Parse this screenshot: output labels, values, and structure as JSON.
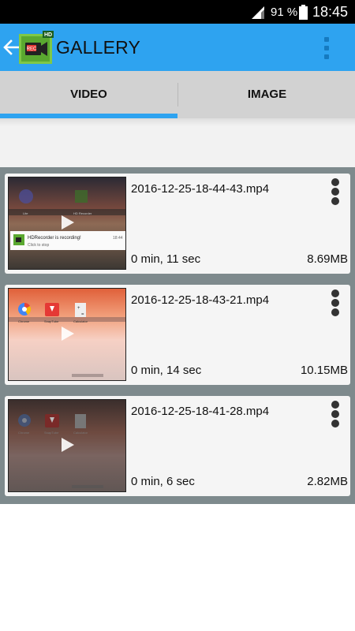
{
  "status_bar": {
    "battery_percent": "91 %",
    "time": "18:45"
  },
  "app_bar": {
    "title": "GALLERY",
    "logo_text": "REC",
    "logo_badge": "HD"
  },
  "tabs": [
    {
      "label": "VIDEO",
      "selected": true
    },
    {
      "label": "IMAGE",
      "selected": false
    }
  ],
  "videos": [
    {
      "filename": "2016-12-25-18-44-43.mp4",
      "duration": "0 min, 11 sec",
      "size": "8.69MB",
      "thumbnail": {
        "notification_title": "HDRecorder is recording!",
        "notification_subtitle": "Click to stop",
        "notification_time": "18:44"
      }
    },
    {
      "filename": "2016-12-25-18-43-21.mp4",
      "duration": "0 min, 14 sec",
      "size": "10.15MB",
      "thumbnail": {
        "app_labels": [
          "Chrome",
          "SnapTube",
          "Calculator"
        ]
      }
    },
    {
      "filename": "2016-12-25-18-41-28.mp4",
      "duration": "0 min, 6 sec",
      "size": "2.82MB",
      "thumbnail": {
        "app_labels": [
          "Chrome",
          "SnapTube",
          "Calculator"
        ]
      }
    }
  ],
  "colors": {
    "app_bar": "#2ea3f0",
    "tab_indicator": "#2ea3f0",
    "list_background": "#7e8a8d"
  }
}
